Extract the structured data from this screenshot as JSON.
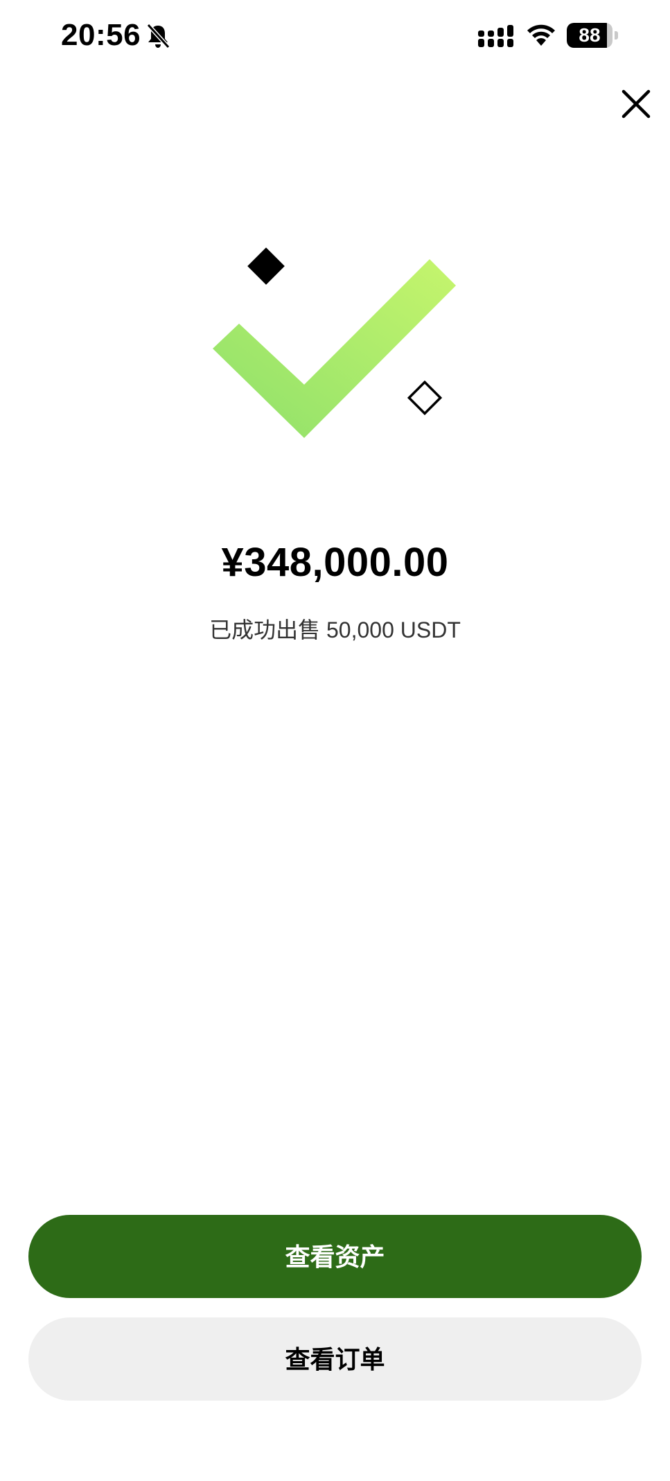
{
  "status_bar": {
    "time": "20:56",
    "battery_level": 88,
    "battery_label": "88",
    "icons": [
      "bell-slash-icon",
      "signal-icon",
      "wifi-icon",
      "battery-icon"
    ]
  },
  "header": {
    "close_icon": "close-icon"
  },
  "success": {
    "icon": "checkmark-icon",
    "amount": "¥348,000.00",
    "message": "已成功出售 50,000 USDT"
  },
  "actions": {
    "primary_label": "查看资产",
    "secondary_label": "查看订单"
  },
  "colors": {
    "primary_button": "#2d6b17",
    "secondary_button": "#efefef",
    "check_gradient_start": "#8ee06a",
    "check_gradient_end": "#c6f56d"
  }
}
